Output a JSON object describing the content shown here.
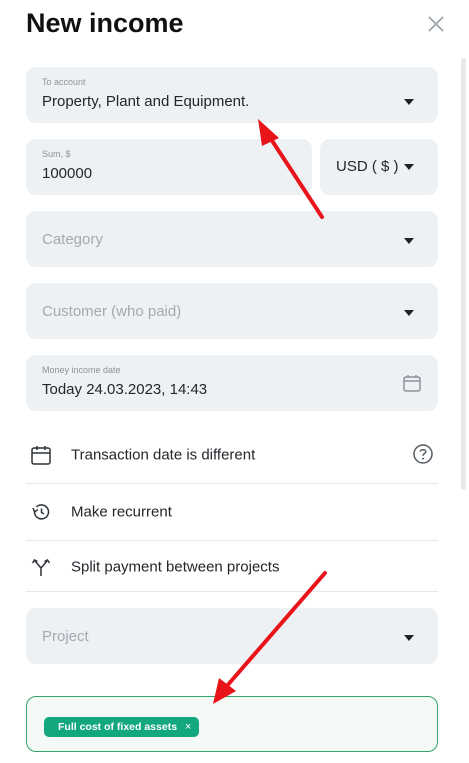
{
  "header": {
    "title": "New income"
  },
  "to_account": {
    "label": "To account",
    "value": "Property, Plant and Equipment."
  },
  "sum": {
    "label": "Sum, $",
    "value": "100000"
  },
  "currency": {
    "value": "USD ( $ )"
  },
  "category": {
    "placeholder": "Category"
  },
  "customer": {
    "placeholder": "Customer (who paid)"
  },
  "date": {
    "label": "Money income date",
    "value": "Today 24.03.2023, 14:43"
  },
  "options": {
    "transaction_date": "Transaction date is different",
    "recurrent": "Make recurrent",
    "split": "Split payment between projects"
  },
  "project": {
    "placeholder": "Project"
  },
  "tags": [
    {
      "label": "Full cost of fixed assets",
      "remove": "×"
    }
  ],
  "colors": {
    "annotation_arrow": "#e8141a",
    "tag_bg": "#12a77f",
    "tag_border": "#36a46a",
    "field_bg": "#edf1f4"
  },
  "icons": [
    "close-icon",
    "calendar-icon",
    "history-icon",
    "split-icon",
    "help-icon",
    "dropdown-caret-icon"
  ]
}
